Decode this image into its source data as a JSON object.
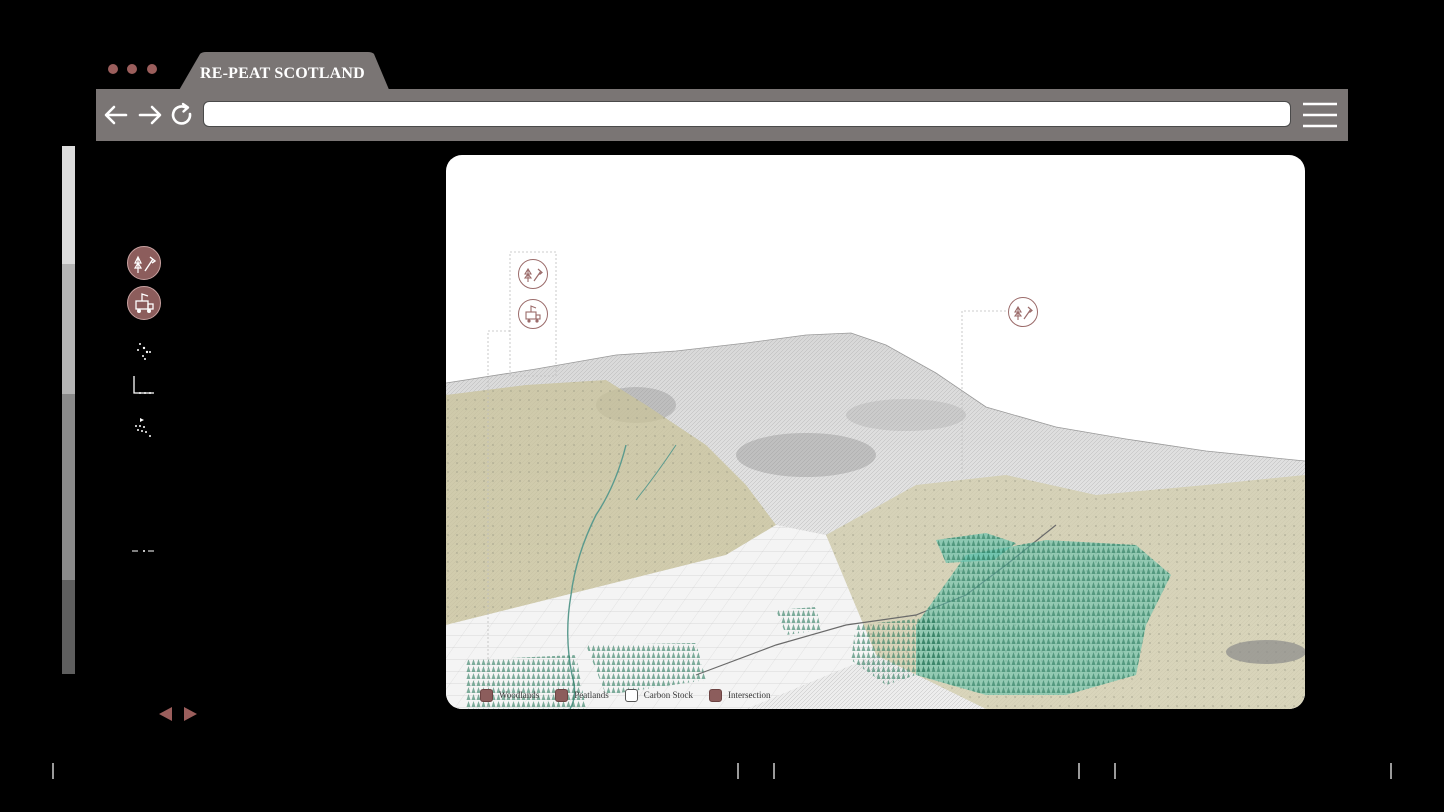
{
  "window": {
    "dot_color": "#9b5e5c",
    "tab_title": "RE-PEAT SCOTLAND",
    "tab_color": "#7a7574"
  },
  "toolbar": {
    "background": "#7a7574",
    "back_icon": "arrow-left-icon",
    "forward_icon": "arrow-right-icon",
    "reload_icon": "reload-icon",
    "url_value": "",
    "menu_icon": "hamburger-menu-icon"
  },
  "sidebar": {
    "items": [
      {
        "icon": "trees-axe-icon"
      },
      {
        "icon": "logging-vehicle-icon"
      },
      {
        "icon": "small-scatter-icon"
      },
      {
        "icon": "axis-icon"
      },
      {
        "icon": "dots-cluster-icon"
      },
      {
        "icon": "small-dash-icon"
      }
    ]
  },
  "map": {
    "pins": [
      {
        "icon": "trees-axe-icon"
      },
      {
        "icon": "logging-vehicle-icon"
      },
      {
        "icon": "trees-axe-icon"
      }
    ],
    "legend": [
      {
        "label": "Woodlands",
        "color": "#8c5d5c"
      },
      {
        "label": "Peatlands",
        "color": "#8c5d5c"
      },
      {
        "label": "Carbon Stock",
        "color": "#ffffff"
      },
      {
        "label": "Intersection",
        "color": "#8c5d5c"
      }
    ]
  },
  "pager": {
    "prev_icon": "triangle-left-icon",
    "next_icon": "triangle-right-icon",
    "color": "#9b5e5c"
  }
}
